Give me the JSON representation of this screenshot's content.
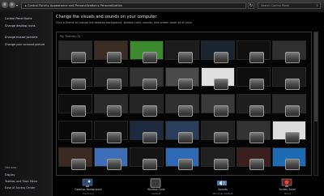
{
  "address_bar": {
    "back_icon": "back-arrow-icon",
    "forward_icon": "forward-arrow-icon",
    "path": "▸ Control Panel ▸ Appearance and Personalization ▸ Personalization",
    "search_placeholder": "Search Control Panel"
  },
  "sidebar": {
    "items": [
      {
        "label": "Control Panel Home"
      },
      {
        "label": "Change desktop icons"
      },
      {
        "label": "Change mouse pointers"
      },
      {
        "label": "Change your account picture"
      }
    ],
    "see_also": "See also",
    "bottom_items": [
      {
        "label": "Display"
      },
      {
        "label": "Taskbar and Start Menu"
      },
      {
        "label": "Ease of Access Center"
      }
    ]
  },
  "main": {
    "heading": "Change the visuals and sounds on your computer",
    "description": "Click a theme to change the desktop background, window color, sounds, and screen saver all at once.",
    "gallery_title": "My Themes (2)",
    "themes": [
      {
        "name": "",
        "bg": "#2a2a2a"
      },
      {
        "name": "",
        "bg": "#3b2d26"
      },
      {
        "name": "",
        "bg": "#3c8a2e"
      },
      {
        "name": "",
        "bg": "#1c1c1c"
      },
      {
        "name": "",
        "bg": "#1a2530"
      },
      {
        "name": "",
        "bg": "#101010"
      },
      {
        "name": "",
        "bg": "#2f2f2f"
      },
      {
        "name": "",
        "bg": "#141414"
      },
      {
        "name": "",
        "bg": "#222222"
      },
      {
        "name": "",
        "bg": "#353535"
      },
      {
        "name": "",
        "bg": "#4a4a4a"
      },
      {
        "name": "",
        "bg": "#e0e0e0"
      },
      {
        "name": "",
        "bg": "#0e0e0e"
      },
      {
        "name": "",
        "bg": "#1a1a1a"
      },
      {
        "name": "",
        "bg": "#0f0f0f"
      },
      {
        "name": "",
        "bg": "#2b2b2b"
      },
      {
        "name": "",
        "bg": "#262626"
      },
      {
        "name": "",
        "bg": "#303030"
      },
      {
        "name": "",
        "bg": "#3a3a3a"
      },
      {
        "name": "",
        "bg": "#1f1f1f"
      },
      {
        "name": "",
        "bg": "#2a2a2a"
      },
      {
        "name": "",
        "bg": "#0a0a0a"
      },
      {
        "name": "",
        "bg": "#111111"
      },
      {
        "name": "",
        "bg": "#1e2a3d"
      },
      {
        "name": "",
        "bg": "#2b3e5c"
      },
      {
        "name": "",
        "bg": "#222222"
      },
      {
        "name": "",
        "bg": "#333333"
      },
      {
        "name": "",
        "bg": "#dcdcdc"
      },
      {
        "name": "",
        "bg": "#3a2a22"
      },
      {
        "name": "",
        "bg": "#3d6fb8"
      },
      {
        "name": "",
        "bg": "#141414"
      },
      {
        "name": "",
        "bg": "#2f69b5"
      },
      {
        "name": "",
        "bg": "#202020"
      },
      {
        "name": "",
        "bg": "#3b1f1f"
      },
      {
        "name": "",
        "bg": "#1d6bb4"
      }
    ]
  },
  "bottom_settings": [
    {
      "label": "Desktop Background",
      "sub": "Harmony",
      "icon": "desktop-background-icon"
    },
    {
      "label": "Window Color",
      "sub": "Default",
      "icon": "window-color-icon"
    },
    {
      "label": "Sounds",
      "sub": "Windows Default",
      "icon": "sounds-icon"
    },
    {
      "label": "Screen Saver",
      "sub": "None",
      "icon": "screen-saver-icon"
    }
  ]
}
